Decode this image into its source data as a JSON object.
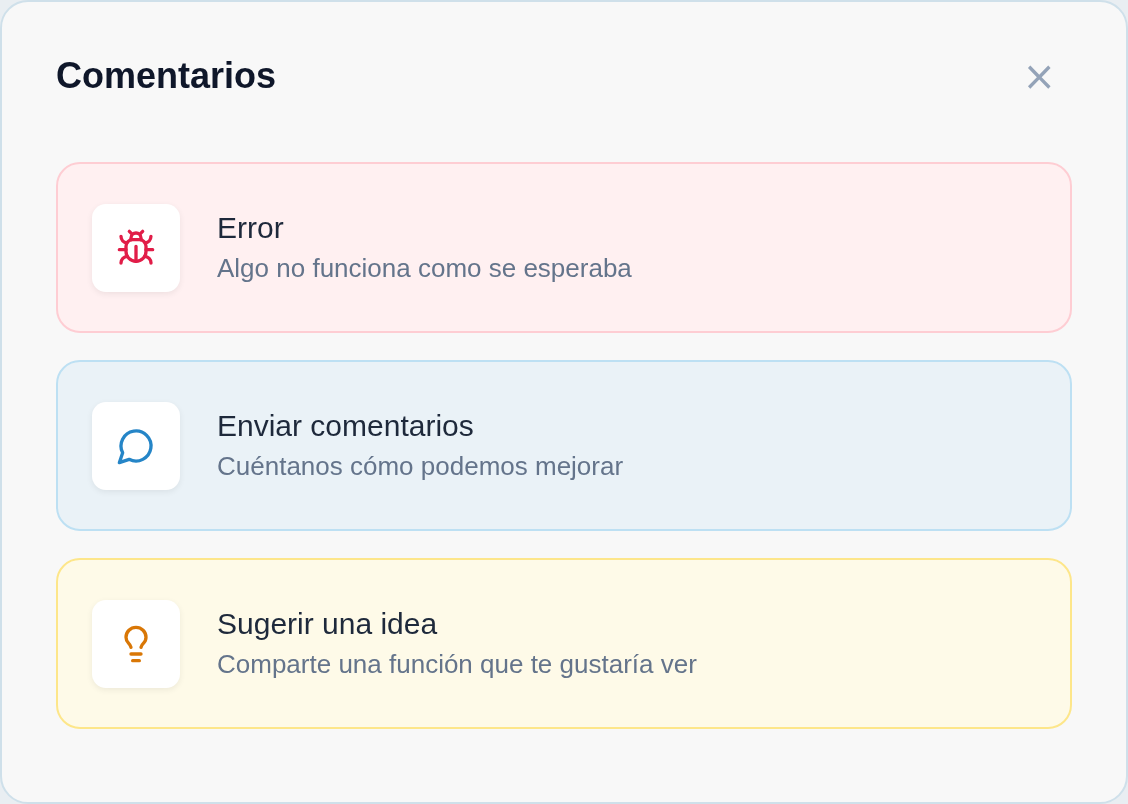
{
  "dialog": {
    "title": "Comentarios",
    "close_label": "×"
  },
  "options": [
    {
      "kind": "bug",
      "title": "Error",
      "description": "Algo no funciona como se esperaba",
      "color": "#e11d48"
    },
    {
      "kind": "chat",
      "title": "Enviar comentarios",
      "description": "Cuéntanos cómo podemos mejorar",
      "color": "#2585c7"
    },
    {
      "kind": "idea",
      "title": "Sugerir una idea",
      "description": "Comparte una función que te gustaría ver",
      "color": "#d97706"
    }
  ]
}
